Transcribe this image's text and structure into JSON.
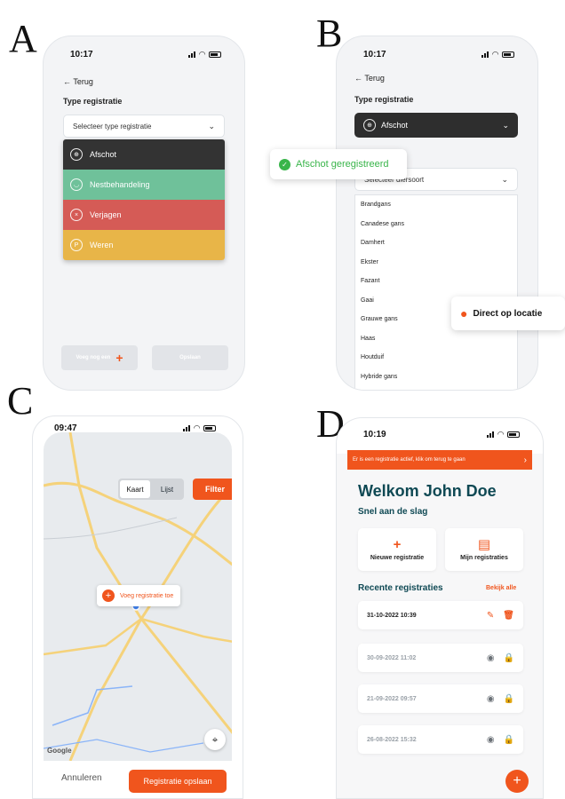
{
  "panels": {
    "a": {
      "letter": "A",
      "time": "10:17",
      "back": "← Terug",
      "field_label": "Type registratie",
      "select_placeholder": "Selecteer type registratie",
      "options": [
        {
          "label": "Afschot",
          "color": "#333333",
          "icon": "crosshair-icon"
        },
        {
          "label": "Nestbehandeling",
          "color": "#6fc19a",
          "icon": "nest-icon"
        },
        {
          "label": "Verjagen",
          "color": "#d55b56",
          "icon": "x-marker-icon"
        },
        {
          "label": "Weren",
          "color": "#e8b548",
          "icon": "p-marker-icon"
        }
      ],
      "add_button": "Voeg nog een",
      "save_button": "Opslaan"
    },
    "b": {
      "letter": "B",
      "time": "10:17",
      "back": "← Terug",
      "field_label": "Type registratie",
      "selected_type": "Afschot",
      "second_select": "Selecteer diersoort",
      "species": [
        "Brandgans",
        "Canadese gans",
        "Damhert",
        "Ekster",
        "Fazant",
        "Gaai",
        "Grauwe gans",
        "Haas",
        "Houtduif",
        "Hybride gans"
      ],
      "toast_success": "Afschot geregistreerd",
      "toast_location": "Direct op locatie"
    },
    "c": {
      "letter": "C",
      "time": "09:47",
      "tab_map": "Kaart",
      "tab_list": "Lijst",
      "filter": "Filter",
      "add_pill": "Voeg registratie toe",
      "google": "Google",
      "cancel": "Annuleren",
      "save": "Registratie opslaan"
    },
    "d": {
      "letter": "D",
      "time": "10:19",
      "banner": "Er is een registratie actief, klik om terug te gaan",
      "welcome": "Welkom John Doe",
      "quick_start": "Snel aan de slag",
      "new_reg": "Nieuwe registratie",
      "my_regs": "Mijn registraties",
      "recent": "Recente registraties",
      "view_all": "Bekijk alle",
      "registrations": [
        {
          "date": "31-10-2022 10:39",
          "active": true
        },
        {
          "date": "30-09-2022 11:02",
          "active": false
        },
        {
          "date": "21-09-2022 09:57",
          "active": false
        },
        {
          "date": "26-08-2022 15:32",
          "active": false
        }
      ]
    }
  },
  "colors": {
    "accent": "#f0551d",
    "dark_teal": "#0f4954",
    "success": "#39b54a"
  }
}
